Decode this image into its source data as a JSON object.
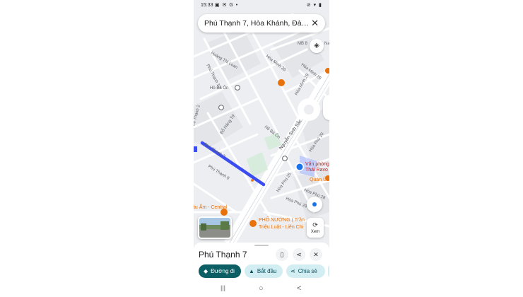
{
  "status_bar": {
    "time": "15:33",
    "left_icons": "▣ ✉ G •",
    "right_icons": "⊘ ▾ ▮"
  },
  "search": {
    "query": "Phú Thạnh 7, Hòa Khánh, Đà…",
    "clear_icon": "close-icon"
  },
  "map": {
    "street_labels": {
      "hoang_thi_loan": "Hoàng Thị Loan",
      "phu_thanh_10": "Phú Thạnh 10",
      "ho_ba_on_top": "Hồ Bá Ôn",
      "hoa_minh_26": "Hòa Minh 26",
      "hoa_minh_25": "Hòa Minh 25",
      "hoa_minh_29": "Hòa Minh 29",
      "do_nang_te": "Đỗ Năng Tế",
      "ho_ba_on_mid": "Hồ Bá Ôn",
      "nguyen_sinh_sac": "Nguyễn Sinh Sắc",
      "phu_thanh_7": "Phú Thạnh 7",
      "phu_thanh_8": "Phú Thạnh 8",
      "hoa_phu_20": "Hòa Phú 20",
      "hoa_phu_25": "Hòa Phú 25",
      "hoa_phu_28": "Hòa Phú 28",
      "hoa_phu_29": "Hòa Phú 29",
      "phu_thanh_2": "Phú Thạnh 2",
      "mb": "MB 8",
      "na": "Na"
    },
    "places": {
      "office_line1": "Văn phòng",
      "office_line2": "Thái Ravo",
      "quan_ut": "Quán Út",
      "central": "âu Ấm - Central",
      "pho_nuong_1": "PHỐ NƯỚNG ( Trần",
      "pho_nuong_2": "Triệu Luật - Liên Chi"
    },
    "colors": {
      "route": "#3b4cf0",
      "location": "#1a73e8",
      "place_pin": "#e8710a",
      "office_text": "#c5221f"
    }
  },
  "controls": {
    "street_view_label": "Xem"
  },
  "place_sheet": {
    "title": "Phú Thạnh 7",
    "actions": [
      {
        "label": "Đường đi",
        "icon": "directions-icon"
      },
      {
        "label": "Bắt đầu",
        "icon": "navigation-arrow-icon"
      },
      {
        "label": "Chia sẻ",
        "icon": "share-icon"
      }
    ]
  },
  "system_nav": {
    "recents": "|||",
    "home": "○",
    "back": "<"
  }
}
